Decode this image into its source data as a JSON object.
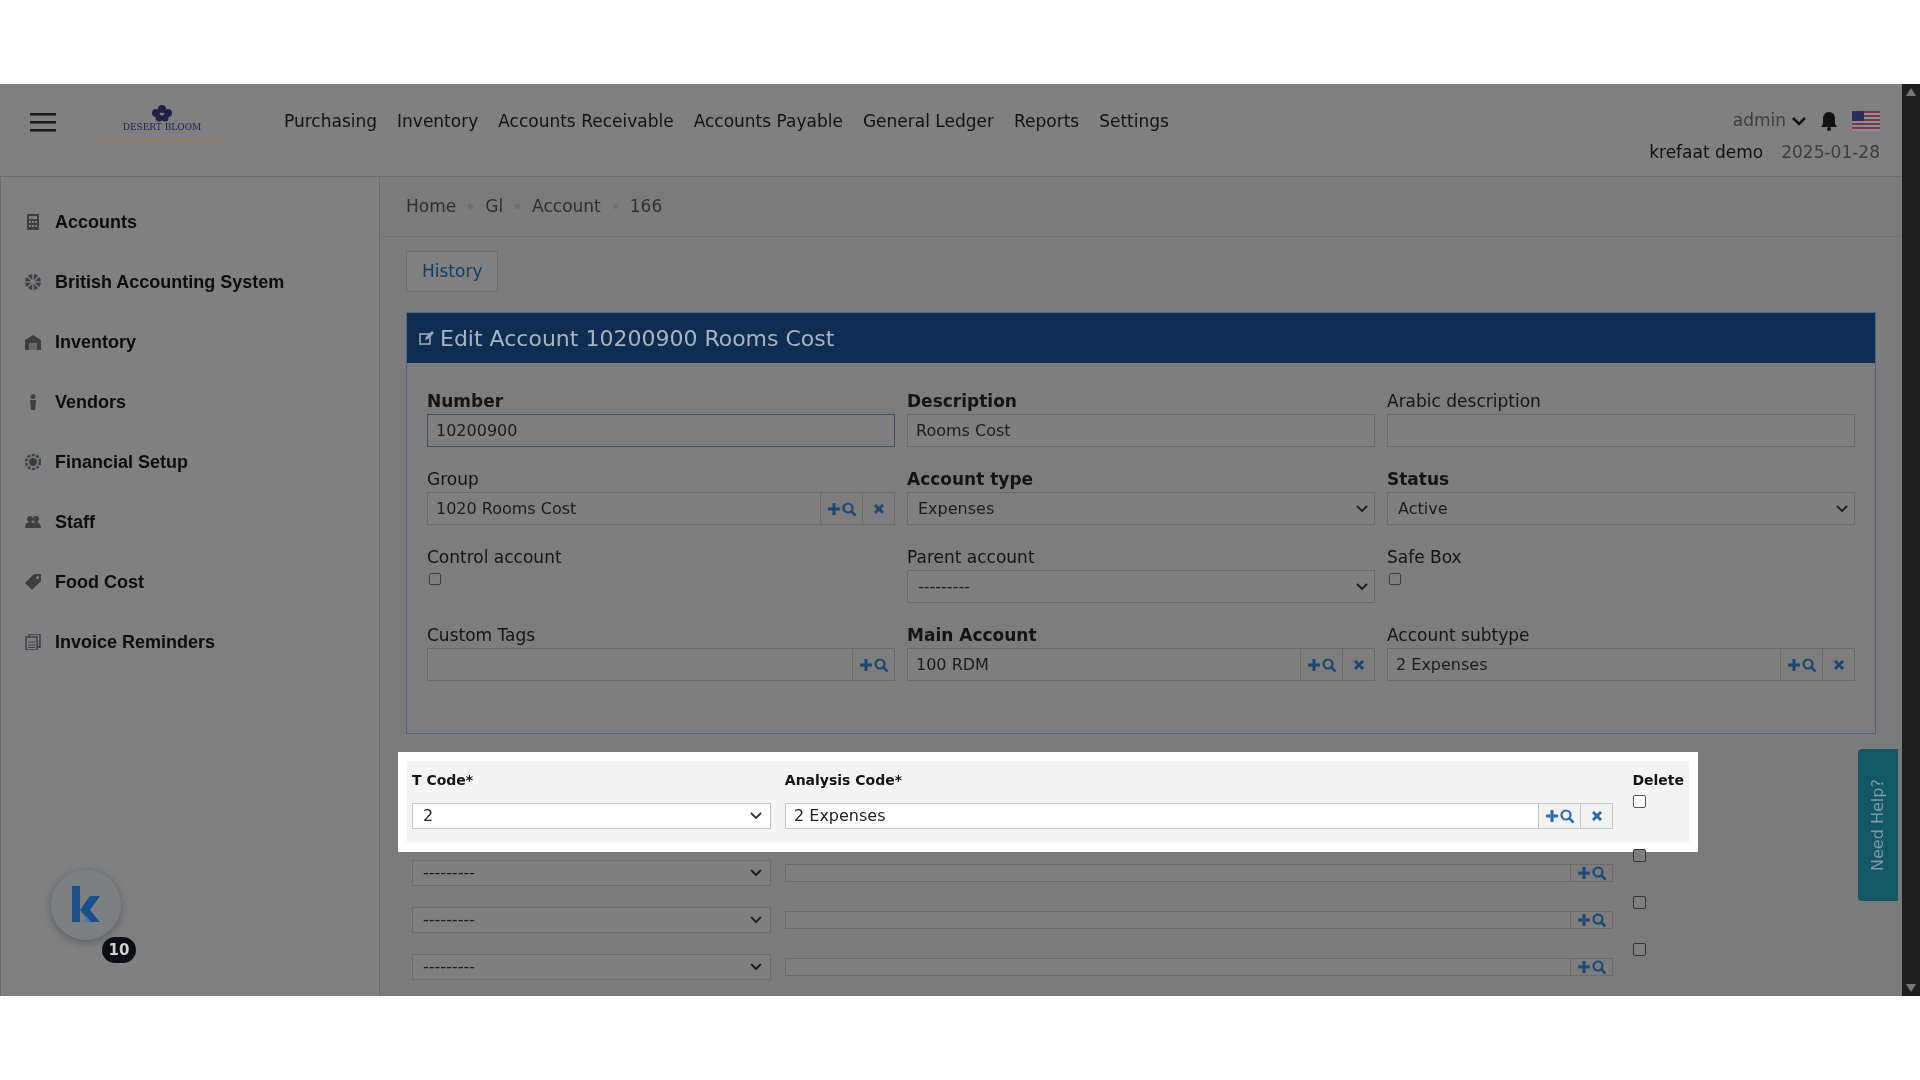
{
  "header": {
    "logo_text": "DESERT BLOOM",
    "nav": [
      "Purchasing",
      "Inventory",
      "Accounts Receivable",
      "Accounts Payable",
      "General Ledger",
      "Reports",
      "Settings"
    ],
    "user": "admin",
    "company": "krefaat demo",
    "date": "2025-01-28"
  },
  "sidebar": {
    "items": [
      {
        "label": "Accounts"
      },
      {
        "label": "British Accounting System"
      },
      {
        "label": "Inventory"
      },
      {
        "label": "Vendors"
      },
      {
        "label": "Financial Setup"
      },
      {
        "label": "Staff"
      },
      {
        "label": "Food Cost"
      },
      {
        "label": "Invoice Reminders"
      }
    ]
  },
  "breadcrumb": [
    "Home",
    "Gl",
    "Account",
    "166"
  ],
  "history_button": "History",
  "panel": {
    "title": "Edit Account 10200900 Rooms Cost",
    "fields": [
      {
        "label": "Number",
        "required": true,
        "kind": "text",
        "value": "10200900",
        "focused": true
      },
      {
        "label": "Description",
        "required": true,
        "kind": "text",
        "value": "Rooms Cost",
        "focused": false
      },
      {
        "label": "Arabic description",
        "required": false,
        "kind": "text",
        "focused": false
      },
      {
        "label": "Group",
        "required": false,
        "kind": "lookup",
        "value": "1020 Rooms Cost",
        "clearable": true
      },
      {
        "label": "Account type",
        "required": true,
        "kind": "select",
        "value": "Expenses"
      },
      {
        "label": "Status",
        "required": true,
        "kind": "select",
        "value": "Active"
      },
      {
        "label": "Control account",
        "required": false,
        "kind": "checkbox",
        "checked": false
      },
      {
        "label": "Parent account",
        "required": false,
        "kind": "select",
        "value": "---------"
      },
      {
        "label": "Safe Box",
        "required": false,
        "kind": "checkbox",
        "checked": false
      },
      {
        "label": "Custom Tags",
        "required": false,
        "kind": "lookup",
        "clearable": false
      },
      {
        "label": "Main Account",
        "required": true,
        "kind": "lookup",
        "value": "100 RDM",
        "clearable": true
      },
      {
        "label": "Account subtype",
        "required": false,
        "kind": "lookup",
        "value": "2 Expenses",
        "clearable": true
      }
    ]
  },
  "analysis": {
    "columns": [
      "T Code*",
      "Analysis Code*",
      "Delete"
    ],
    "rows": [
      {
        "t_code": "2",
        "analysis_code": "2 Expenses",
        "clearable": true,
        "delete": false,
        "highlighted": true
      },
      {
        "t_code": "---------",
        "clearable": false,
        "delete": false,
        "highlighted": false
      },
      {
        "t_code": "---------",
        "clearable": false,
        "delete": false,
        "highlighted": false
      },
      {
        "t_code": "---------",
        "clearable": false,
        "delete": false,
        "highlighted": false
      }
    ]
  },
  "help_tab": "Need Help?",
  "assistant_badge": "10"
}
